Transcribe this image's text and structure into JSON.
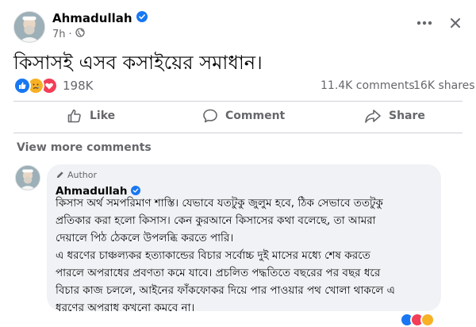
{
  "post": {
    "author": "Ahmadullah",
    "time": "7h",
    "dot": "·",
    "text": "কিসাসই এসব কসাইয়ের সমাধান।",
    "reactions_count": "198K",
    "comments_count": "11.4K comments",
    "shares_count": "16K shares",
    "more_icon": "more-horizontal-icon",
    "close_icon": "close-icon"
  },
  "actions": {
    "like": "Like",
    "comment": "Comment",
    "share": "Share"
  },
  "comments": {
    "view_more": "View more comments",
    "author_badge": "Author",
    "author_name": "Ahmadullah",
    "paragraph1_lines": [
      "কিসাস অর্থ সমপরিমাণ শাস্তি। যেভাবে যতটুকু জুলুম হবে, ঠিক সেভাবে ততটুকু",
      "প্রতিকার করা হলো কিসাস। কেন কুরআনে কিসাসের কথা বলেছে, তা আমরা",
      "দেয়ালে পিঠ ঠেকলে উপলব্ধি করতে পারি।"
    ],
    "paragraph2_lines": [
      "এ ধরণের চাঞ্চল্যকর হত্যাকান্ডের বিচার সর্বোচ্চ দুই মাসের মধ্যে শেষ করতে",
      "পারলে অপরাধের প্রবণতা কমে যাবে। প্রচলিত পদ্ধতিতে বছরের পর বছর ধরে",
      "বিচার কাজ চললে, আইনের ফাঁকফোকর দিয়ে পার পাওয়ার পথ খোলা থাকলে এ",
      "ধরণের অপরাধ কখনো কমবে না।"
    ]
  },
  "colors": {
    "verified": "#1877f2",
    "like": "#1877f2",
    "love": "#f33e58",
    "care": "#f7b125"
  }
}
